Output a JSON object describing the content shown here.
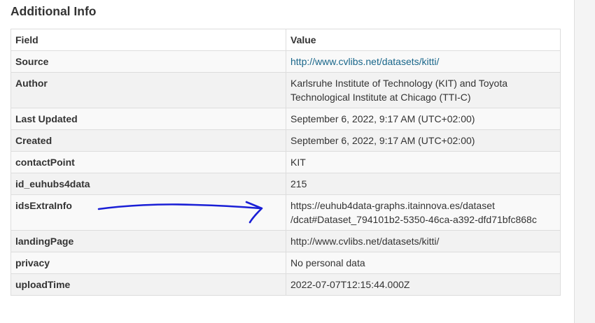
{
  "section_title": "Additional Info",
  "table": {
    "headers": {
      "field": "Field",
      "value": "Value"
    },
    "rows": [
      {
        "field": "Source",
        "value": "http://www.cvlibs.net/datasets/kitti/",
        "is_link": true
      },
      {
        "field": "Author",
        "value": "Karlsruhe Institute of Technology (KIT) and Toyota Technological Institute at Chicago (TTI-C)"
      },
      {
        "field": "Last Updated",
        "value": "September 6, 2022, 9:17 AM (UTC+02:00)"
      },
      {
        "field": "Created",
        "value": "September 6, 2022, 9:17 AM (UTC+02:00)"
      },
      {
        "field": "contactPoint",
        "value": "KIT"
      },
      {
        "field": "id_euhubs4data",
        "value": "215"
      },
      {
        "field": "idsExtraInfo",
        "value_line1": "https://euhub4data-graphs.itainnova.es/dataset",
        "value_line2": "/dcat#Dataset_794101b2-5350-46ca-a392-dfd71bfc868c"
      },
      {
        "field": "landingPage",
        "value": "http://www.cvlibs.net/datasets/kitti/"
      },
      {
        "field": "privacy",
        "value": "No personal data"
      },
      {
        "field": "uploadTime",
        "value": "2022-07-07T12:15:44.000Z"
      }
    ]
  },
  "annotation": {
    "icon": "hand-drawn-arrow-icon",
    "color": "#1a1fd6"
  },
  "colors": {
    "link": "#19668a",
    "row_odd": "#f9f9f9",
    "row_even": "#f2f2f2",
    "border": "#dddddd"
  }
}
